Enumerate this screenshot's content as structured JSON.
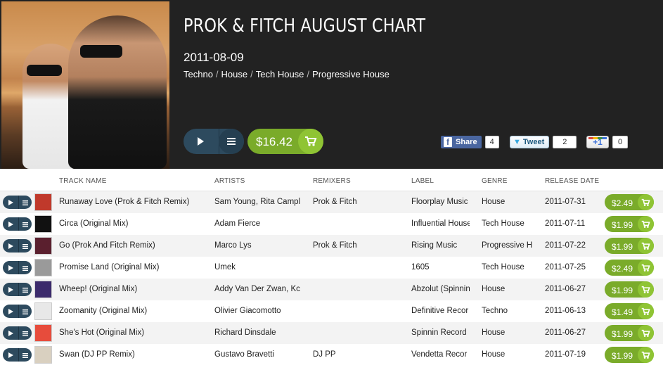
{
  "chart": {
    "title": "PROK & FITCH AUGUST CHART",
    "date": "2011-08-09",
    "genres": [
      "Techno",
      "House",
      "Tech House",
      "Progressive House"
    ],
    "genre_separator": "/",
    "total_price": "$16.42"
  },
  "social": {
    "facebook": {
      "label": "Share",
      "icon": "f",
      "count": "4"
    },
    "twitter": {
      "label": "Tweet",
      "count": "2"
    },
    "googleplus": {
      "label": "+1",
      "count": "0"
    }
  },
  "columns": {
    "track": "TRACK NAME",
    "artists": "ARTISTS",
    "remixers": "REMIXERS",
    "label": "LABEL",
    "genre": "GENRE",
    "release": "RELEASE DATE"
  },
  "tracks": [
    {
      "name": "Runaway Love (Prok & Fitch Remix)",
      "artists": "Sam Young, Rita Campl",
      "remixers": "Prok & Fitch",
      "label": "Floorplay Music",
      "genre": "House",
      "release": "2011-07-31",
      "price": "$2.49",
      "thumb_color": "#c0392b"
    },
    {
      "name": "Circa (Original Mix)",
      "artists": "Adam Fierce",
      "remixers": "",
      "label": "Influential House",
      "genre": "Tech House",
      "release": "2011-07-11",
      "price": "$1.99",
      "thumb_color": "#111111"
    },
    {
      "name": "Go (Prok And Fitch Remix)",
      "artists": "Marco Lys",
      "remixers": "Prok & Fitch",
      "label": "Rising Music",
      "genre": "Progressive H",
      "release": "2011-07-22",
      "price": "$1.99",
      "thumb_color": "#5a1f2e"
    },
    {
      "name": "Promise Land (Original Mix)",
      "artists": "Umek",
      "remixers": "",
      "label": "1605",
      "genre": "Tech House",
      "release": "2011-07-25",
      "price": "$2.49",
      "thumb_color": "#9a9a9a"
    },
    {
      "name": "Wheep! (Original Mix)",
      "artists": "Addy Van Der Zwan, Kc",
      "remixers": "",
      "label": "Abzolut (Spinnin",
      "genre": "House",
      "release": "2011-06-27",
      "price": "$1.99",
      "thumb_color": "#3b2a6b"
    },
    {
      "name": "Zoomanity (Original Mix)",
      "artists": "Olivier Giacomotto",
      "remixers": "",
      "label": "Definitive Recor",
      "genre": "Techno",
      "release": "2011-06-13",
      "price": "$1.49",
      "thumb_color": "#e8e8e8"
    },
    {
      "name": "She's Hot (Original Mix)",
      "artists": "Richard Dinsdale",
      "remixers": "",
      "label": "Spinnin Record",
      "genre": "House",
      "release": "2011-06-27",
      "price": "$1.99",
      "thumb_color": "#e74c3c"
    },
    {
      "name": "Swan (DJ PP Remix)",
      "artists": "Gustavo Bravetti",
      "remixers": "DJ PP",
      "label": "Vendetta Recor",
      "genre": "House",
      "release": "2011-07-19",
      "price": "$1.99",
      "thumb_color": "#d9d0c0"
    }
  ],
  "icons": {
    "play": "play-icon",
    "queue": "queue-list-icon",
    "cart": "cart-icon"
  },
  "colors": {
    "header_bg": "#222222",
    "play_bg": "#2d4a5e",
    "buy_green": "#7aab2a",
    "buy_cart_green": "#8fc434"
  }
}
